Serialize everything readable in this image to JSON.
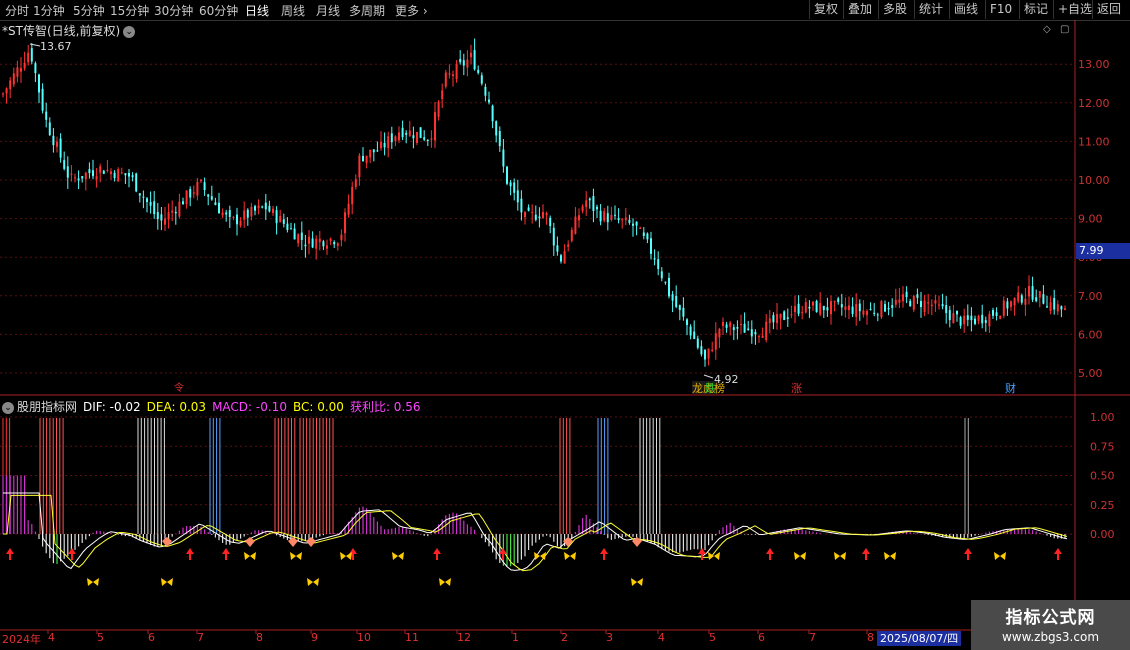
{
  "toolbar": {
    "periods": [
      "分时",
      "1分钟",
      "5分钟",
      "15分钟",
      "30分钟",
      "60分钟",
      "日线",
      "周线",
      "月线",
      "多周期",
      "更多"
    ],
    "more_arrow": "›",
    "active_period": "日线",
    "buttons": [
      "复权",
      "叠加",
      "多股",
      "统计",
      "画线",
      "F10",
      "标记",
      "+自选",
      "返回"
    ]
  },
  "stock": {
    "title": "*ST传智(日线,前复权)",
    "high_label": "13.67",
    "low_label": "4.92",
    "current_price": "7.99",
    "price_axis": [
      "13.00",
      "12.00",
      "11.00",
      "10.00",
      "9.00",
      "8.00",
      "7.00",
      "6.00",
      "5.00"
    ],
    "events": [
      {
        "label": "龙虎榜",
        "color": "#e8b000"
      },
      {
        "label": "跌",
        "color": "#2fbf2f"
      },
      {
        "label": "涨",
        "color": "#e03030"
      },
      {
        "label": "财",
        "color": "#4aa0ff"
      }
    ]
  },
  "indicator": {
    "name": "股朋指标网",
    "dif": "DIF: -0.02",
    "dea": "DEA: 0.03",
    "macd": "MACD: -0.10",
    "bc": "BC: 0.00",
    "profit": "获利比: 0.56",
    "axis": [
      "1.00",
      "0.75",
      "0.50",
      "0.25",
      "0.00"
    ]
  },
  "date_axis": {
    "labels": [
      "2024年",
      "4",
      "5",
      "6",
      "7",
      "8",
      "9",
      "10",
      "11",
      "12",
      "1",
      "2",
      "3",
      "4",
      "5",
      "6",
      "7",
      "8"
    ],
    "cursor_date": "2025/08/07/四"
  },
  "watermark": {
    "line1": "指标公式网",
    "line2": "www.zbgs3.com"
  },
  "colors": {
    "up": "#ff3232",
    "down": "#54ffff",
    "background": "#000000",
    "accent": "#1c2fa0"
  }
}
